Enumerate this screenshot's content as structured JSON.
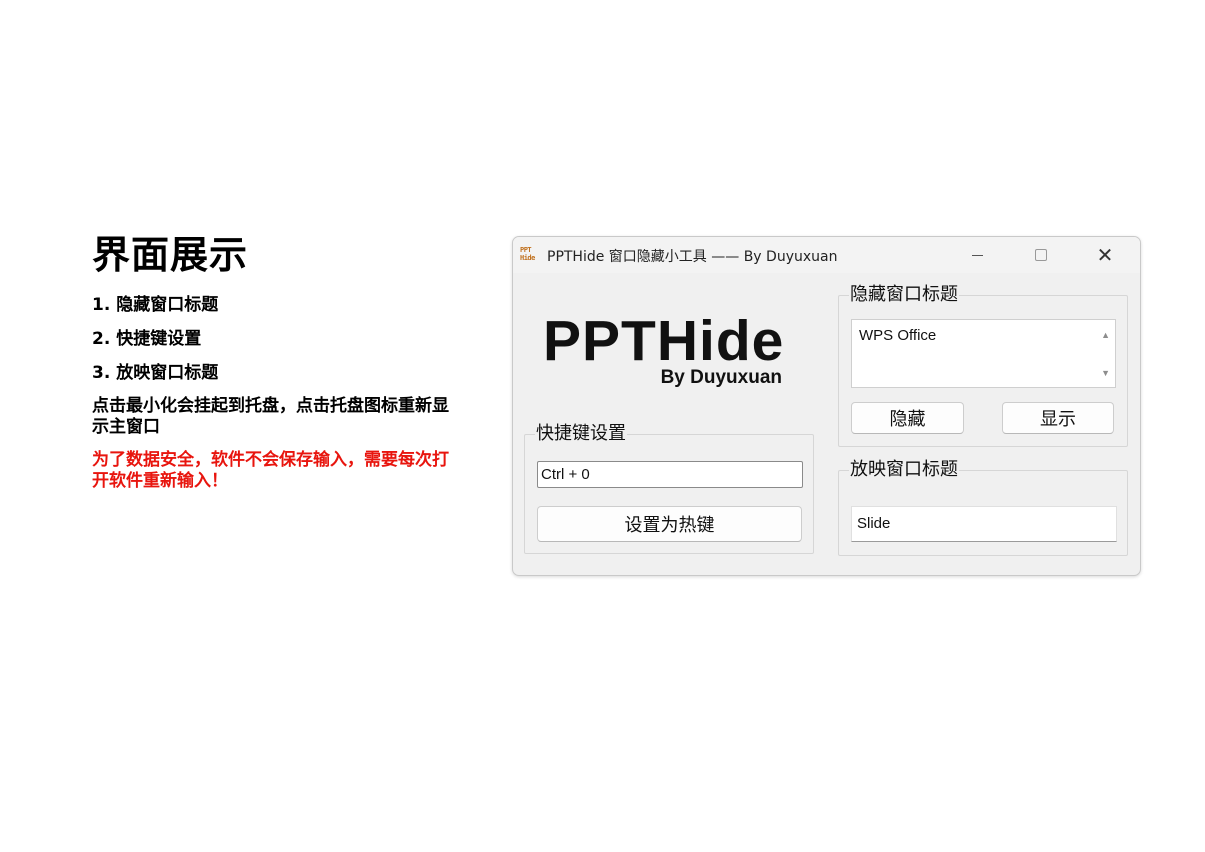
{
  "page": {
    "heading": "界面展示",
    "features": [
      "1. 隐藏窗口标题",
      "2. 快捷键设置",
      "3. 放映窗口标题"
    ],
    "note": "点击最小化会挂起到托盘，点击托盘图标重新显示主窗口",
    "warning": "为了数据安全，软件不会保存输入，需要每次打开软件重新输入！",
    "warning_color": "#e8150e"
  },
  "window": {
    "icon_text_top": "PPT",
    "icon_text_bottom": "Hide",
    "title": "PPTHide 窗口隐藏小工具 —— By Duyuxuan",
    "controls": [
      "minimize-icon",
      "maximize-icon",
      "close-icon"
    ],
    "close_glyph": "✕"
  },
  "logo": {
    "main": "PPTHide",
    "sub": "By Duyuxuan"
  },
  "hotkey": {
    "group_title": "快捷键设置",
    "value": "Ctrl + 0",
    "button_label": "设置为热键"
  },
  "hide": {
    "group_title": "隐藏窗口标题",
    "value": "WPS Office",
    "scroll_up": "▲",
    "scroll_down": "▼",
    "hide_label": "隐藏",
    "show_label": "显示"
  },
  "slideshow": {
    "group_title": "放映窗口标题",
    "value": "Slide"
  }
}
